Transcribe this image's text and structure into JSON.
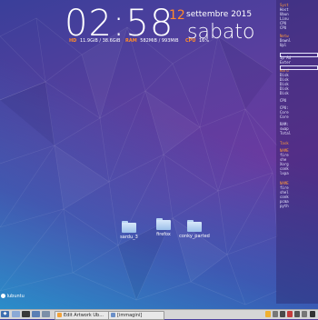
{
  "clock": {
    "time": "02:58",
    "day_number": "12",
    "month_year": "settembre 2015",
    "weekday": "sabato"
  },
  "stats": {
    "hd_label": "HD",
    "hd_value": "11.9GiB / 38.6GiB",
    "ram_label": "RAM",
    "ram_value": "582MiB / 993MiB",
    "cpu_label": "CPU",
    "cpu_value": "16%"
  },
  "right_panel": {
    "lines": [
      {
        "text": "Syst",
        "head": true
      },
      {
        "text": "Host",
        "head": false
      },
      {
        "text": "Ubun",
        "head": false
      },
      {
        "text": "Linu",
        "head": false
      },
      {
        "text": "CPU",
        "head": false
      },
      {
        "text": "CPU",
        "head": false
      },
      {
        "text": "Netw",
        "head": true
      },
      {
        "text": "Downl",
        "head": false
      },
      {
        "text": "Upl",
        "head": false
      },
      {
        "text": "Ip Ad",
        "head": false
      },
      {
        "text": "Exter",
        "head": false
      },
      {
        "text": "Hard",
        "head": true
      },
      {
        "text": "Disk",
        "head": false
      },
      {
        "text": "Disk",
        "head": false
      },
      {
        "text": "Disk",
        "head": false
      },
      {
        "text": "Disk",
        "head": false
      },
      {
        "text": "Disk",
        "head": false
      },
      {
        "text": "CPU",
        "head": false
      },
      {
        "text": "CPU:",
        "head": false
      },
      {
        "text": "Core",
        "head": false
      },
      {
        "text": "Core",
        "head": false
      },
      {
        "text": "RAM:",
        "head": false
      },
      {
        "text": "swap",
        "head": false
      },
      {
        "text": "Total",
        "head": false
      },
      {
        "text": "Task",
        "head": true
      },
      {
        "text": "NAME",
        "head": true
      },
      {
        "text": "fire",
        "head": false
      },
      {
        "text": "she",
        "head": false
      },
      {
        "text": "Xorg",
        "head": false
      },
      {
        "text": "conk",
        "head": false
      },
      {
        "text": "lxpa",
        "head": false
      },
      {
        "text": "NAME",
        "head": true
      },
      {
        "text": "fire",
        "head": false
      },
      {
        "text": "shel",
        "head": false
      },
      {
        "text": "conk",
        "head": false
      },
      {
        "text": "pcma",
        "head": false
      },
      {
        "text": "pyth",
        "head": false
      }
    ]
  },
  "desktop_icons": [
    {
      "label": "sardu_3",
      "name": "folder-icon-sardu"
    },
    {
      "label": "firefox",
      "name": "folder-icon-firefox"
    },
    {
      "label": "conky_parted",
      "name": "folder-icon-conky"
    }
  ],
  "corner_logo": "lubuntu",
  "taskbar": {
    "start_glyph": "◆",
    "tasks": [
      {
        "label": "Edit Artwork Ub...",
        "color": "#f2a23a"
      },
      {
        "label": "[immagini]",
        "color": "#6a8fc8"
      }
    ]
  },
  "colors": {
    "accent": "#ff8a2a",
    "text": "#ffffff"
  }
}
